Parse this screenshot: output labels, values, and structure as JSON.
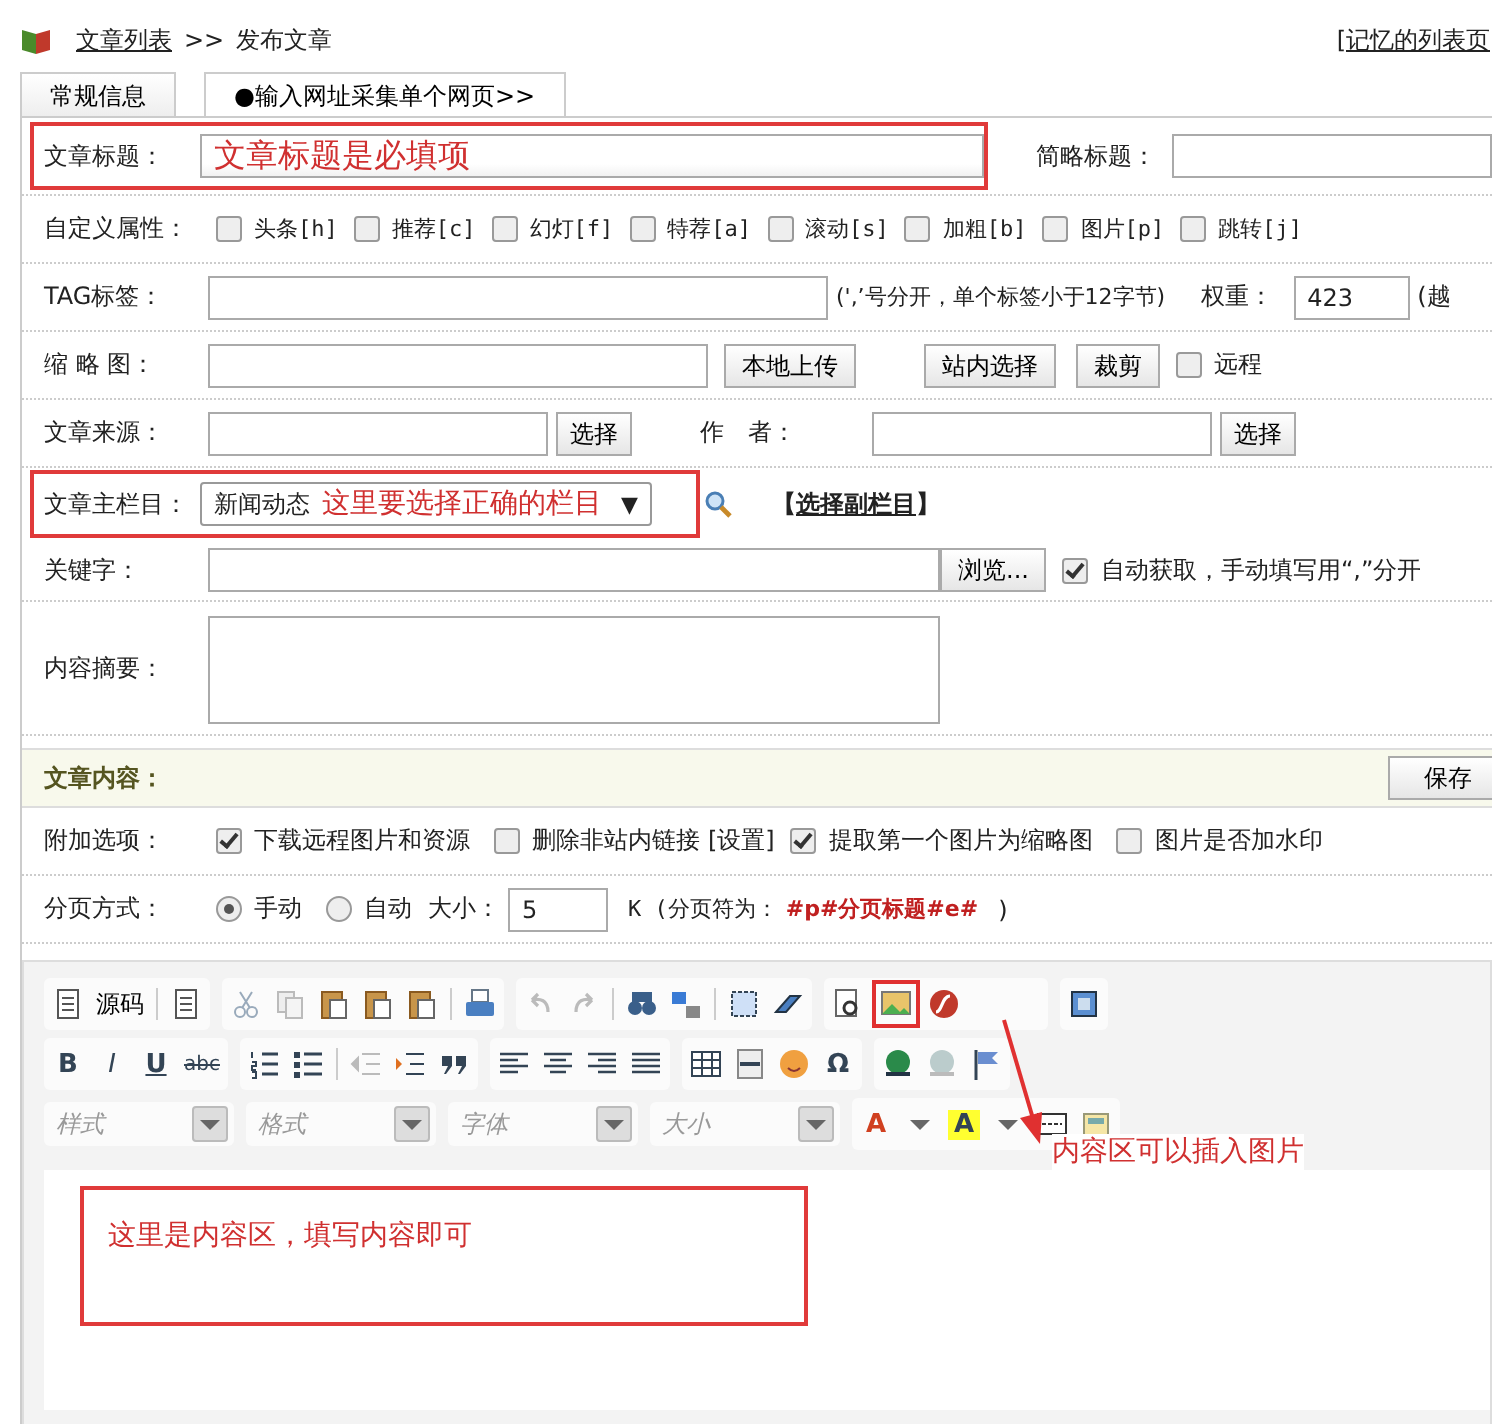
{
  "breadcrumb": {
    "link": "文章列表",
    "separator": ">>",
    "current": "发布文章",
    "right_link": "[记忆的列表页"
  },
  "tabs": [
    {
      "label": "常规信息",
      "selected": true
    },
    {
      "label": "●输入网址采集单个网页>>",
      "selected": false
    }
  ],
  "title_row": {
    "label": "文章标题：",
    "note": "文章标题是必填项",
    "short_label": "简略标题："
  },
  "attributes": {
    "label": "自定义属性：",
    "flags": [
      {
        "label": "头条[h]",
        "checked": false
      },
      {
        "label": "推荐[c]",
        "checked": false
      },
      {
        "label": "幻灯[f]",
        "checked": false
      },
      {
        "label": "特荐[a]",
        "checked": false
      },
      {
        "label": "滚动[s]",
        "checked": false
      },
      {
        "label": "加粗[b]",
        "checked": false
      },
      {
        "label": "图片[p]",
        "checked": false
      },
      {
        "label": "跳转[j]",
        "checked": false
      }
    ]
  },
  "tags": {
    "label": "TAG标签：",
    "hint": "(',’号分开，单个标签小于12字节)",
    "weight_label": "权重：",
    "weight": "423",
    "weight_hint": "(越"
  },
  "thumbnail": {
    "label": "缩 略 图：",
    "upload": "本地上传",
    "buttons": [
      "站内选择",
      "裁剪"
    ],
    "remote": {
      "label": "远程",
      "checked": false
    }
  },
  "source": {
    "label": "文章来源：",
    "button": "选择",
    "author_label": "作　者：",
    "author_button": "选择"
  },
  "category": {
    "label": "文章主栏目：",
    "value": "新闻动态",
    "note": "这里要选择正确的栏目",
    "caret": "▼",
    "sub_open": "【",
    "sub_link": "选择副栏目",
    "sub_close": "】"
  },
  "keywords": {
    "label": "关键字：",
    "button": "浏览...",
    "auto": {
      "label": "自动获取，手动填写用“,”分开",
      "checked": true
    }
  },
  "summary": {
    "label": "内容摘要："
  },
  "content_section": {
    "title": "文章内容：",
    "save": "保存"
  },
  "extras": {
    "label": "附加选项：",
    "options": [
      {
        "label": "下载远程图片和资源",
        "checked": true
      },
      {
        "label": "删除非站内链接",
        "checked": false,
        "link": "[设置]"
      },
      {
        "label": "提取第一个图片为缩略图",
        "checked": true
      },
      {
        "label": "图片是否加水印",
        "checked": false
      }
    ]
  },
  "paging": {
    "label": "分页方式：",
    "modes": [
      {
        "label": "手动",
        "selected": true
      },
      {
        "label": "自动",
        "selected": false
      }
    ],
    "size_label": "大小：",
    "size": "5",
    "unit": "K (分页符为：",
    "marker": "#p#分页标题#e#",
    "close": ")"
  },
  "editor": {
    "source_button": "源码",
    "format_buttons": [
      "B",
      "I",
      "U",
      "abc"
    ],
    "special_char": "Ω",
    "combos": [
      "样式",
      "格式",
      "字体",
      "大小"
    ],
    "color_buttons": [
      "A",
      "A"
    ],
    "image_note": "内容区可以插入图片",
    "content_note": "这里是内容区，填写内容即可"
  }
}
